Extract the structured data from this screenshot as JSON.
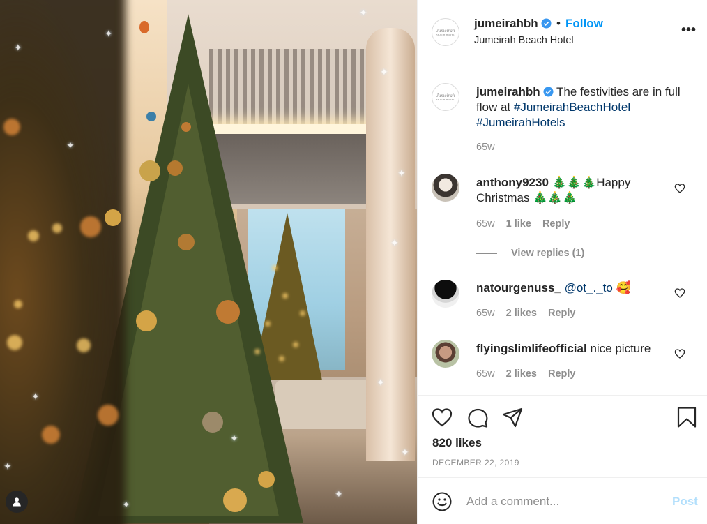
{
  "post": {
    "author": "jumeirahbh",
    "follow_label": "Follow",
    "separator": "•",
    "location": "Jumeirah Beach Hotel",
    "logo_text_1": "Jumeirah",
    "logo_text_2": "BEACH HOTEL",
    "more_label": "•••"
  },
  "caption": {
    "username": "jumeirahbh",
    "text": "The festivities are in full flow at",
    "hashtag1": "#JumeirahBeachHotel",
    "hashtag2": "#JumeirahHotels",
    "time": "65w"
  },
  "comments": [
    {
      "username": "anthony9230",
      "trees1": "🎄🎄🎄",
      "text": "Happy Christmas",
      "trees2": "🎄🎄🎄",
      "time": "65w",
      "likes": "1 like",
      "reply": "Reply",
      "view_replies": "View replies (1)"
    },
    {
      "username": "natourgenuss_",
      "mention": "@ot_._to",
      "emoji": "🥰",
      "time": "65w",
      "likes": "2 likes",
      "reply": "Reply"
    },
    {
      "username": "flyingslimlifeofficial",
      "text": "nice picture",
      "time": "65w",
      "likes": "2 likes",
      "reply": "Reply"
    }
  ],
  "stats": {
    "likes": "820 likes",
    "date": "DECEMBER 22, 2019"
  },
  "composer": {
    "placeholder": "Add a comment...",
    "post_label": "Post"
  },
  "colors": {
    "link": "#0095f6",
    "hashtag": "#00376b",
    "muted": "#8e8e8e",
    "post_disabled": "#b2dffc"
  },
  "icons": {
    "heart": "heart-icon",
    "comment": "comment-icon",
    "share": "paper-plane-icon",
    "save": "bookmark-icon",
    "verified": "verified-badge-icon",
    "more": "more-options-icon",
    "emoji": "smiley-icon",
    "tag": "user-tag-icon"
  }
}
